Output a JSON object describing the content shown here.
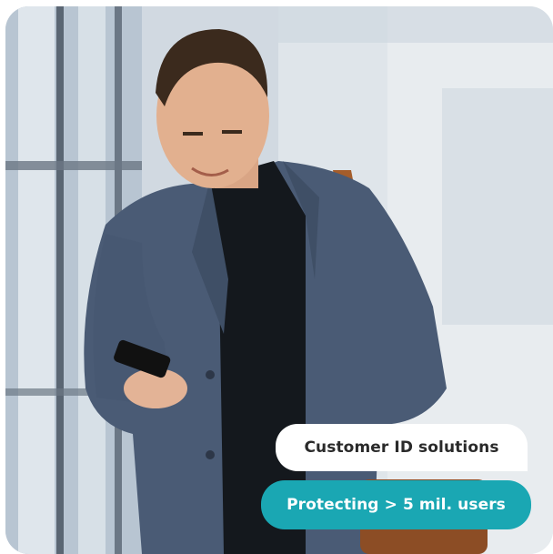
{
  "badge": {
    "title": "Customer ID solutions",
    "subtitle": "Protecting > 5 mil. users"
  },
  "photo": {
    "subject": "man in blue blazer smiling at smartphone in airport corridor"
  },
  "colors": {
    "accent": "#1aa7b3",
    "pill_text_dark": "#2a2a2a",
    "pill_bg_light": "#ffffff"
  }
}
